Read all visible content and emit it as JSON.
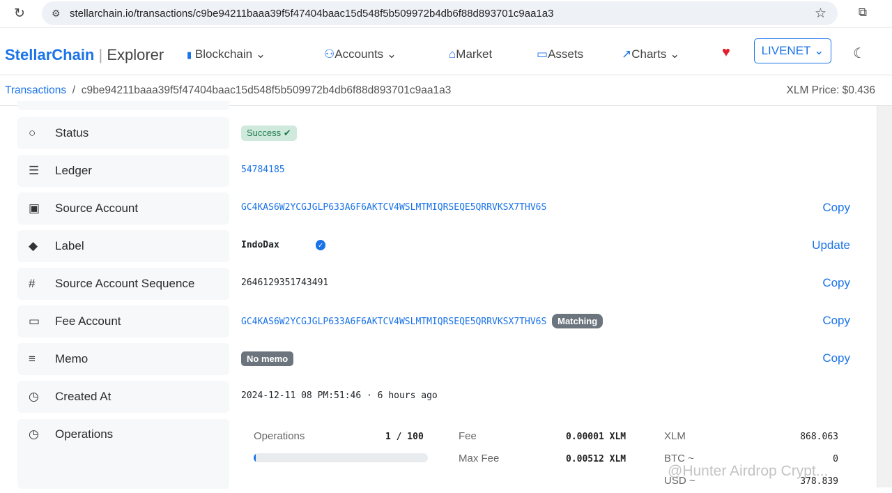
{
  "browser": {
    "url": "stellarchain.io/transactions/c9be94211baaa39f5f47404baac15d548f5b509972b4db6f88d893701c9aa1a3"
  },
  "nav": {
    "logo_main": "StellarChain",
    "logo_sub": "Explorer",
    "items": [
      "Blockchain",
      "Accounts",
      "Market",
      "Assets",
      "Charts"
    ],
    "network": "LIVENET"
  },
  "breadcrumb": {
    "parent": "Transactions",
    "current": "c9be94211baaa39f5f47404baac15d548f5b509972b4db6f88d893701c9aa1a3",
    "price": "XLM Price: $0.436"
  },
  "rows": {
    "status": {
      "label": "Status",
      "value": "Success"
    },
    "ledger": {
      "label": "Ledger",
      "value": "54784185"
    },
    "source": {
      "label": "Source Account",
      "value": "GC4KAS6W2YCGJGLP633A6F6AKTCV4WSLMTMIQRSEQE5QRRVKSX7THV6S",
      "action": "Copy"
    },
    "tag": {
      "label": "Label",
      "value": "IndoDax",
      "action": "Update"
    },
    "seq": {
      "label": "Source Account Sequence",
      "value": "2646129351743491",
      "action": "Copy"
    },
    "fee": {
      "label": "Fee Account",
      "value": "GC4KAS6W2YCGJGLP633A6F6AKTCV4WSLMTMIQRSEQE5QRRVKSX7THV6S",
      "badge": "Matching",
      "action": "Copy"
    },
    "memo": {
      "label": "Memo",
      "value": "No memo",
      "action": "Copy"
    },
    "created": {
      "label": "Created At",
      "value": "2024-12-11 08 PM:51:46 · 6 hours ago"
    },
    "operations": {
      "label": "Operations",
      "ops_label": "Operations",
      "ops_value": "1 / 100",
      "ops_progress": 0.01,
      "fee_label": "Fee",
      "fee_value": "0.00001 XLM",
      "maxfee_label": "Max Fee",
      "maxfee_value": "0.00512 XLM",
      "xlm_label": "XLM",
      "xlm_value": "868.063",
      "btc_label": "BTC ~",
      "btc_value": "0",
      "usd_label": "USD ~",
      "usd_value": "378.839"
    }
  },
  "watermark": "@Hunter Airdrop Crypt..."
}
